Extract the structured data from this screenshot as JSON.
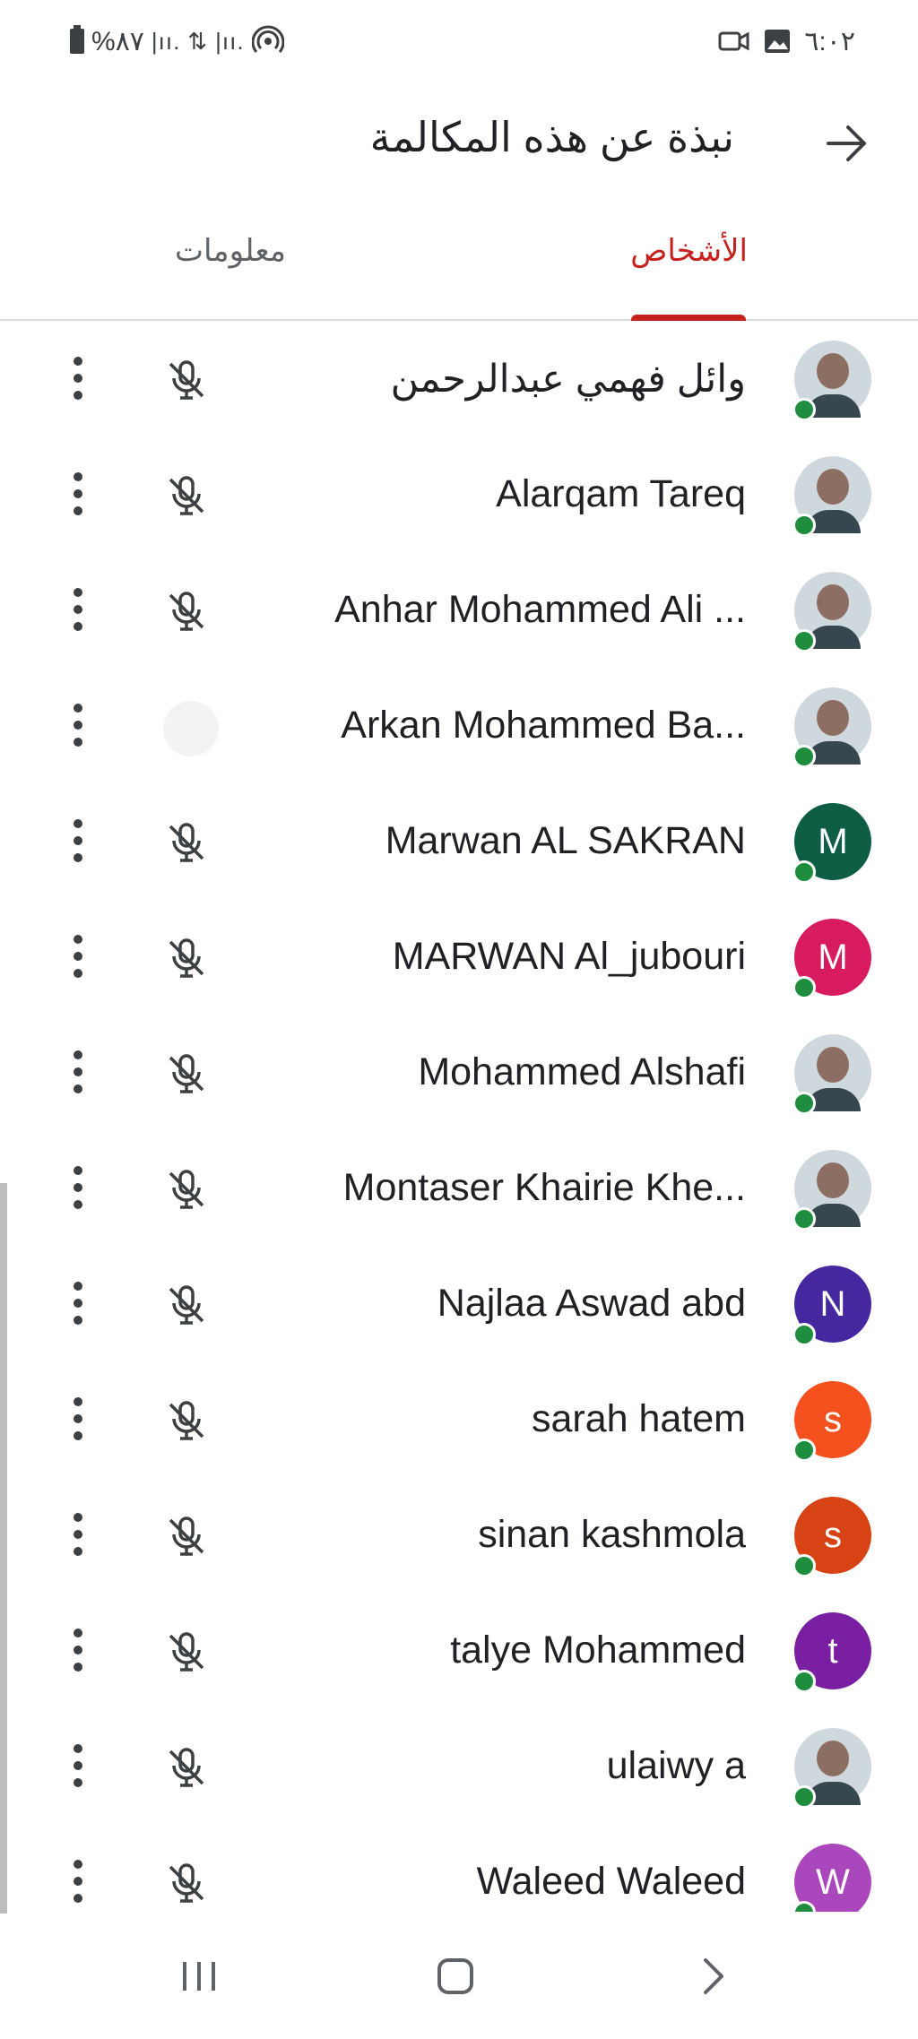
{
  "status_bar": {
    "battery_text": "%٨٧",
    "time": "٦:٠٢"
  },
  "header": {
    "title": "نبذة عن هذه المكالمة"
  },
  "tabs": {
    "people_label": "الأشخاص",
    "info_label": "معلومات"
  },
  "colors": {
    "accent": "#c5221f",
    "online": "#1e8e3e"
  },
  "participants": [
    {
      "name": "وائل فهمي عبدالرحمن",
      "avatar": "photo",
      "mic": "muted"
    },
    {
      "name": "Alarqam Tareq",
      "avatar": "photo",
      "mic": "muted"
    },
    {
      "name": "Anhar Mohammed Ali ...",
      "avatar": "photo",
      "mic": "muted"
    },
    {
      "name": "Arkan Mohammed Ba...",
      "avatar": "photo",
      "mic": "speaking"
    },
    {
      "name": "Marwan AL SAKRAN",
      "avatar_letter": "M",
      "avatar_color": "#0d5e45",
      "mic": "muted"
    },
    {
      "name": "MARWAN Al_jubouri",
      "avatar_letter": "M",
      "avatar_color": "#d81b60",
      "mic": "muted"
    },
    {
      "name": "Mohammed Alshafi",
      "avatar": "photo",
      "mic": "muted"
    },
    {
      "name": "Montaser Khairie Khe...",
      "avatar": "photo",
      "mic": "muted"
    },
    {
      "name": "Najlaa Aswad abd",
      "avatar_letter": "N",
      "avatar_color": "#4527a0",
      "mic": "muted"
    },
    {
      "name": "sarah hatem",
      "avatar_letter": "s",
      "avatar_color": "#f4511e",
      "mic": "muted"
    },
    {
      "name": "sinan kashmola",
      "avatar_letter": "s",
      "avatar_color": "#d84315",
      "mic": "muted"
    },
    {
      "name": "talye Mohammed",
      "avatar_letter": "t",
      "avatar_color": "#7b1fa2",
      "mic": "muted"
    },
    {
      "name": "ulaiwy a",
      "avatar": "photo",
      "mic": "muted"
    },
    {
      "name": "Waleed Waleed",
      "avatar_letter": "W",
      "avatar_color": "#ab47bc",
      "mic": "muted"
    }
  ]
}
